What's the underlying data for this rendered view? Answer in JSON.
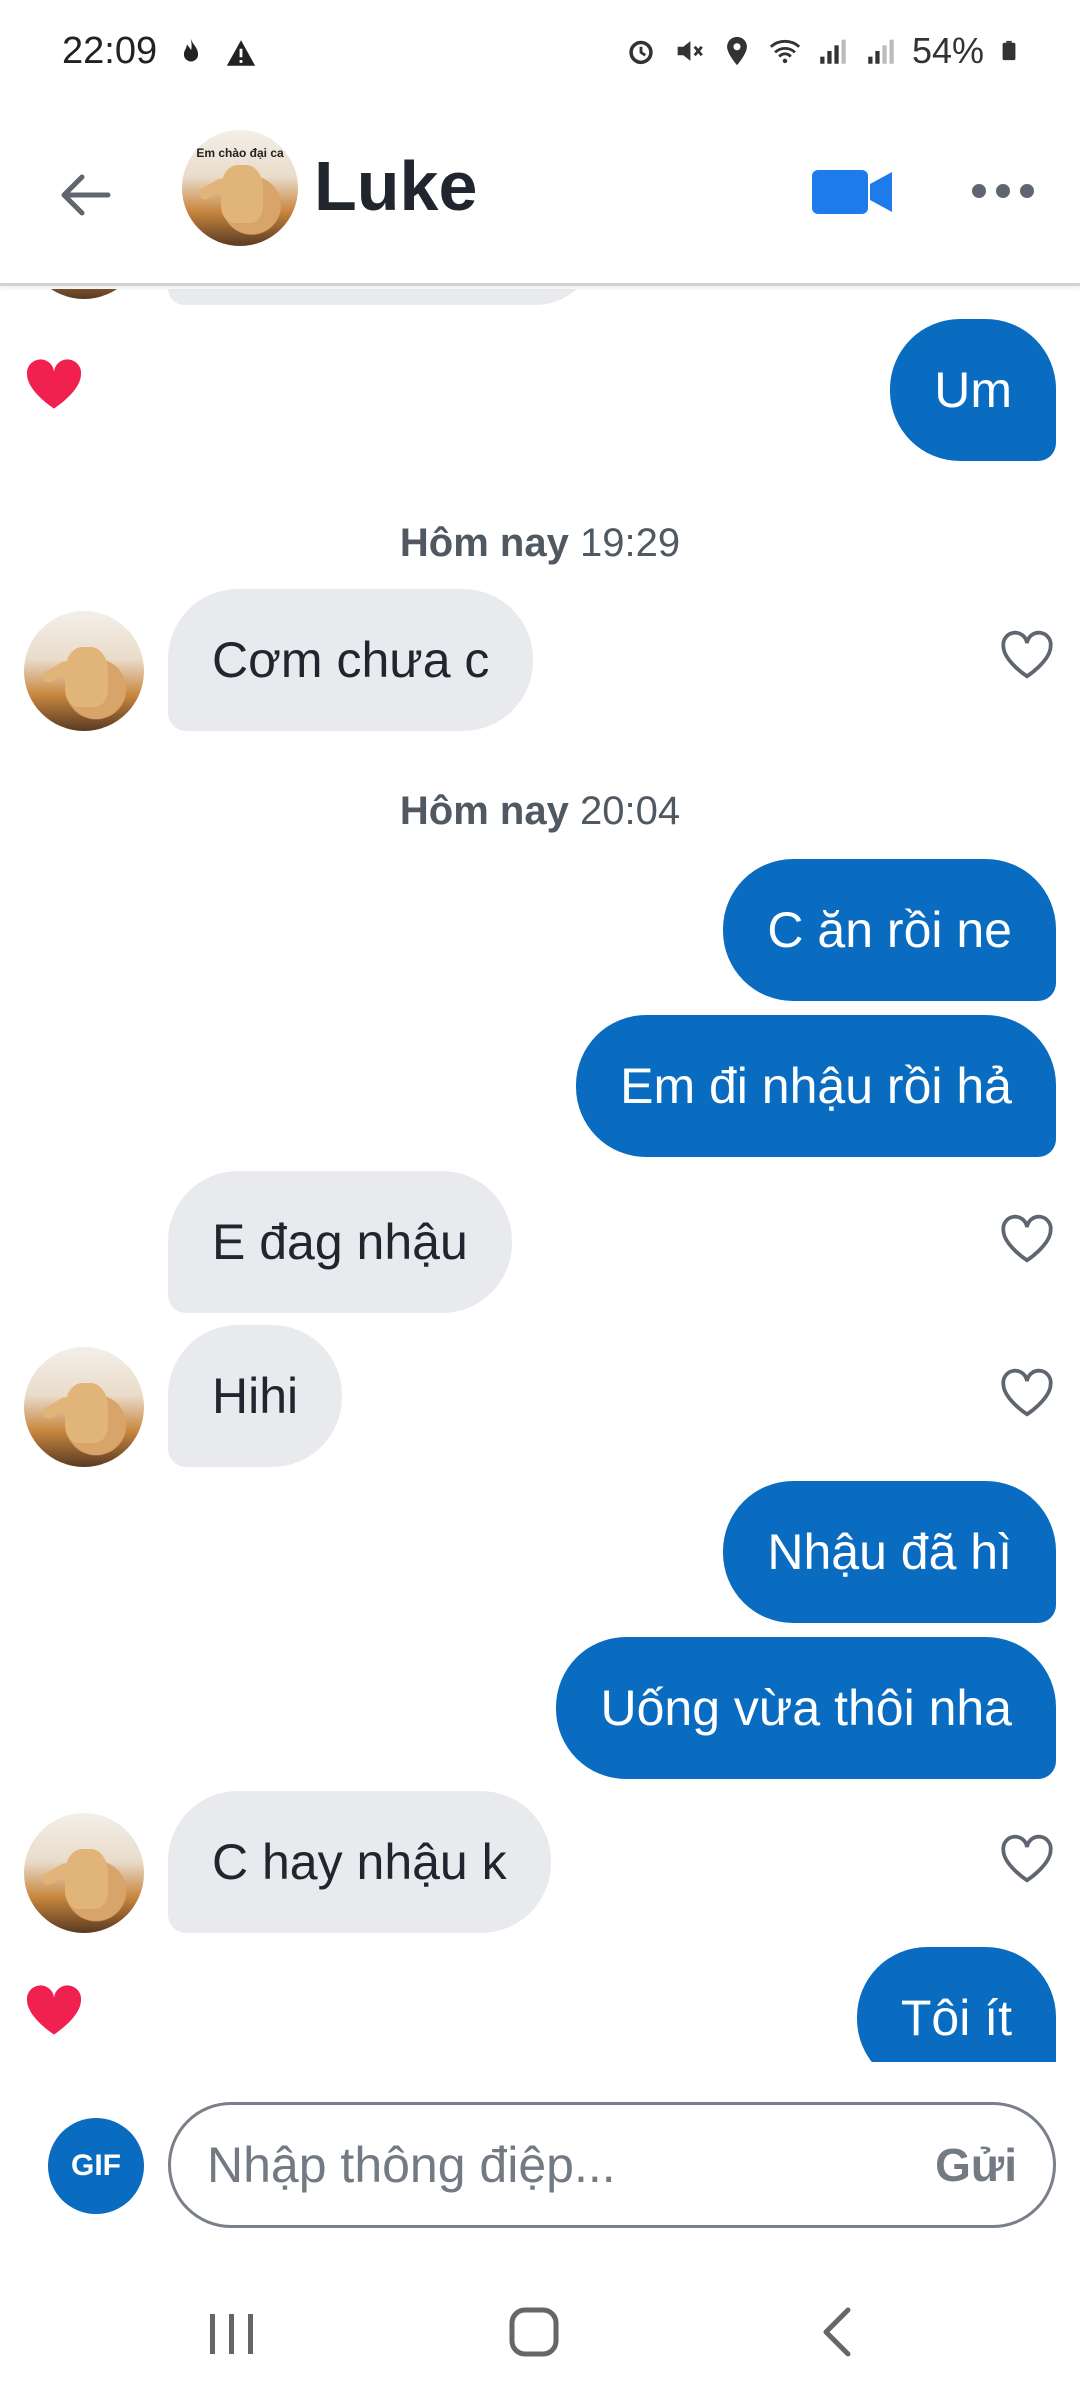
{
  "status_bar": {
    "time": "22:09",
    "battery": "54%",
    "icons": [
      "flame-icon",
      "warning-icon",
      "alarm-icon",
      "mute-icon",
      "location-icon",
      "wifi-icon",
      "signal-icon",
      "signal-icon",
      "battery-icon"
    ]
  },
  "header": {
    "contact_name": "Luke",
    "avatar_caption": "Em chào đại ca",
    "back_icon": "back-arrow-icon",
    "video_icon": "video-camera-icon",
    "more_icon": "more-dots-icon"
  },
  "messages": {
    "items": [
      {
        "type": "out",
        "text": "Um",
        "liked": true
      },
      {
        "type": "timestamp",
        "day": "Hôm nay",
        "time": "19:29"
      },
      {
        "type": "in",
        "text": "Cơm chưa c",
        "liked": false
      },
      {
        "type": "timestamp",
        "day": "Hôm nay",
        "time": "20:04"
      },
      {
        "type": "out",
        "text": "C ăn rồi ne"
      },
      {
        "type": "out",
        "text": "Em đi nhậu rồi hả"
      },
      {
        "type": "in",
        "text": "E đag nhậu",
        "liked": false
      },
      {
        "type": "in",
        "text": "Hihi",
        "liked": false
      },
      {
        "type": "out",
        "text": "Nhậu đã hì"
      },
      {
        "type": "out",
        "text": "Uống vừa thôi nha"
      },
      {
        "type": "in",
        "text": "C hay nhậu k",
        "liked": false
      },
      {
        "type": "out",
        "text": "Tôi ít",
        "liked": true
      }
    ]
  },
  "composer": {
    "gif_label": "GIF",
    "placeholder": "Nhập thông điệp...",
    "send_label": "Gửi"
  },
  "nav": {
    "icons": [
      "recent-apps-icon",
      "home-icon",
      "back-icon"
    ]
  },
  "colors": {
    "accent": "#0a6cc1",
    "incoming_bubble": "#e9eaee",
    "like_red": "#f0214f"
  }
}
